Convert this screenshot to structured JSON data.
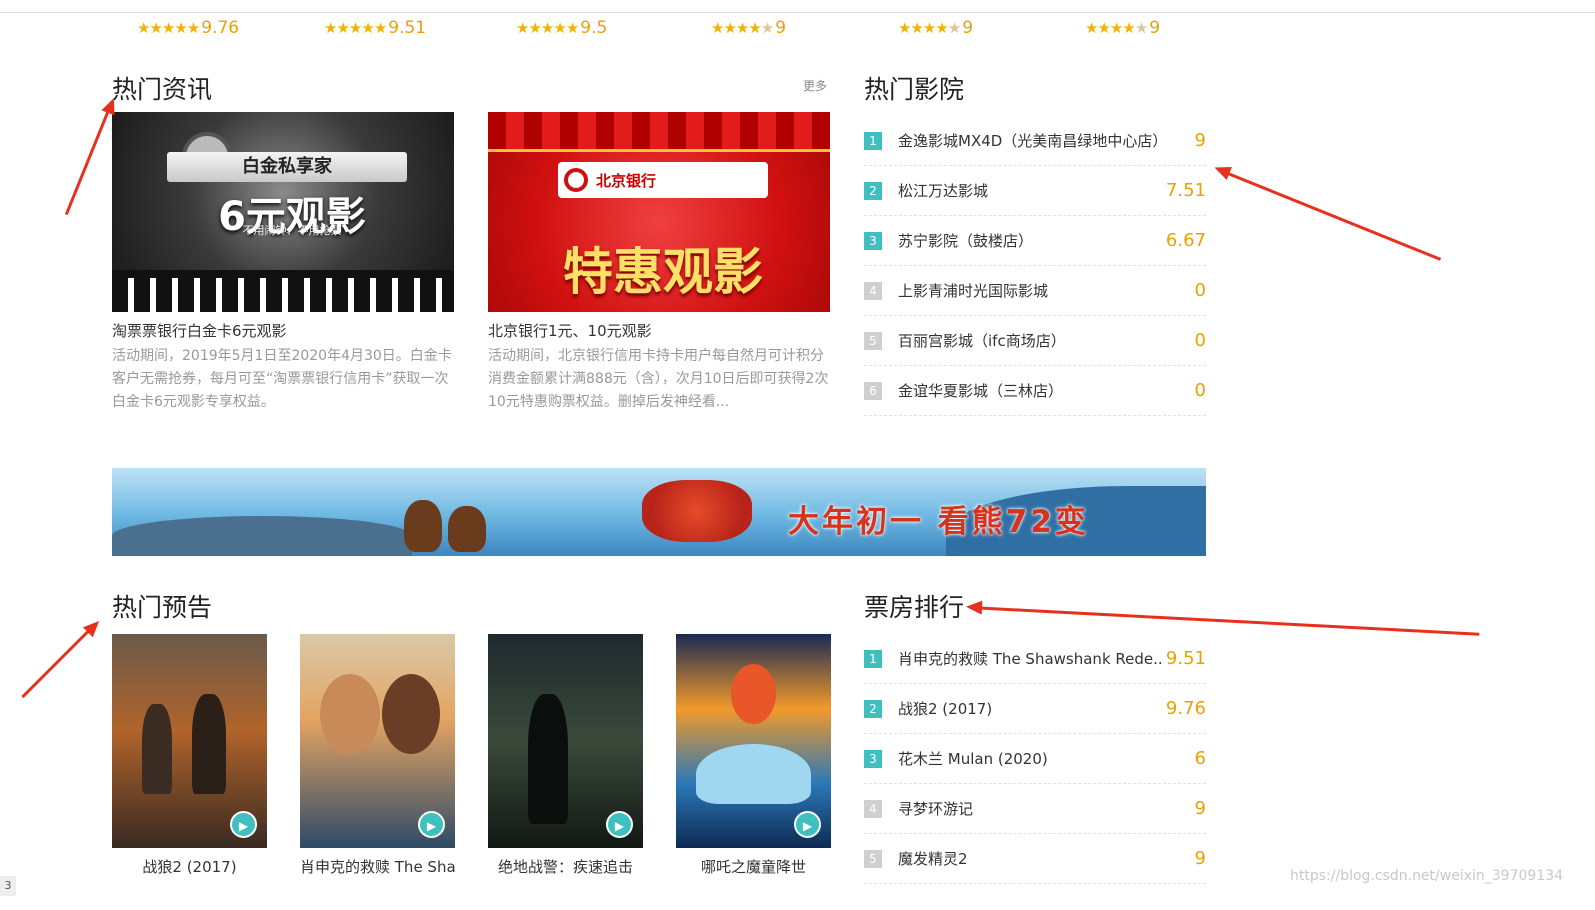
{
  "top_ratings": [
    {
      "score": "9.76",
      "stars": 5
    },
    {
      "score": "9.51",
      "stars": 5
    },
    {
      "score": "9.5",
      "stars": 5
    },
    {
      "score": "9",
      "stars": 4.5
    },
    {
      "score": "9",
      "stars": 4.5
    },
    {
      "score": "9",
      "stars": 4.5
    }
  ],
  "news": {
    "title": "热门资讯",
    "more_label": "更多",
    "items": [
      {
        "title": "淘票票银行白金卡6元观影",
        "desc": "活动期间，2019年5月1日至2020年4月30日。白金卡客户无需抢券，每月可至“淘票票银行信用卡”获取一次白金卡6元观影专享权益。",
        "img_text": {
          "ribbon": "白金私享家",
          "big": "6元观影",
          "sub": "不用闹钟、不用抢票"
        }
      },
      {
        "title": "北京银行1元、10元观影",
        "desc": "活动期间，北京银行信用卡持卡用户每自然月可计积分消费金额累计满888元（含），次月10日后即可获得2次10元特惠购票权益。删掉后发神经看...",
        "img_text": {
          "logo": "北京银行",
          "promo": "特惠观影"
        }
      }
    ]
  },
  "cinemas": {
    "title": "热门影院",
    "items": [
      {
        "rank": "1",
        "name": "金逸影城MX4D（光美南昌绿地中心店）",
        "score": "9"
      },
      {
        "rank": "2",
        "name": "松江万达影城",
        "score": "7.51"
      },
      {
        "rank": "3",
        "name": "苏宁影院（鼓楼店）",
        "score": "6.67"
      },
      {
        "rank": "4",
        "name": "上影青浦时光国际影城",
        "score": "0"
      },
      {
        "rank": "5",
        "name": "百丽宫影城（ifc商场店）",
        "score": "0"
      },
      {
        "rank": "6",
        "name": "金谊华夏影城（三林店）",
        "score": "0"
      }
    ]
  },
  "banner": {
    "slogan": "大年初一 看熊72变"
  },
  "trailers": {
    "title": "热门预告",
    "items": [
      {
        "title": "战狼2 (2017)"
      },
      {
        "title": "肖申克的救赎 The Shawshank Redemption"
      },
      {
        "title": "绝地战警：疾速追击"
      },
      {
        "title": "哪吒之魔童降世"
      }
    ]
  },
  "boxoffice": {
    "title": "票房排行",
    "items": [
      {
        "rank": "1",
        "name": "肖申克的救赎 The Shawshank Rede...",
        "score": "9.51"
      },
      {
        "rank": "2",
        "name": "战狼2 (2017)",
        "score": "9.76"
      },
      {
        "rank": "3",
        "name": "花木兰 Mulan (2020)",
        "score": "6"
      },
      {
        "rank": "4",
        "name": "寻梦环游记",
        "score": "9"
      },
      {
        "rank": "5",
        "name": "魔发精灵2",
        "score": "9"
      }
    ]
  },
  "watermark": "https://blog.csdn.net/weixin_39709134",
  "corner_label": "3",
  "colors": {
    "accent": "#3ec0c0",
    "score": "#e8a200",
    "annotation": "#e8301e"
  }
}
